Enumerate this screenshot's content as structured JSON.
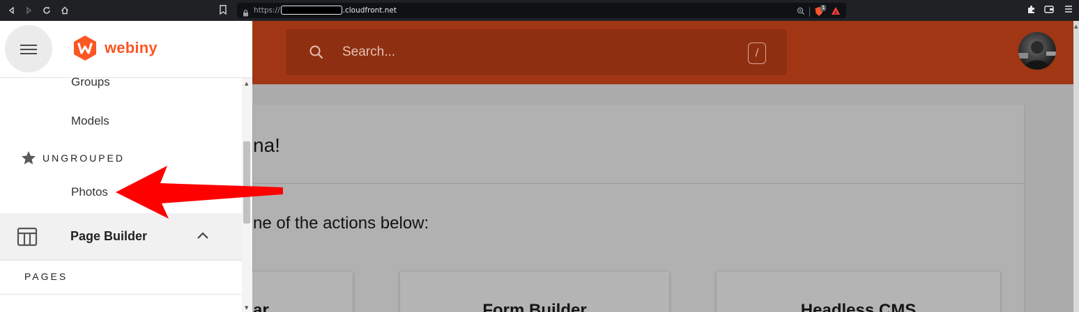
{
  "browser": {
    "url_scheme": "https://",
    "url_domain": ".cloudfront.net",
    "brave_badge": "1"
  },
  "header": {
    "search_placeholder": "Search...",
    "search_shortcut": "/"
  },
  "drawer": {
    "brand": "webiny",
    "items": {
      "groups": "Groups",
      "models": "Models",
      "ungrouped": "UNGROUPED",
      "photos": "Photos",
      "page_builder": "Page Builder",
      "pages": "PAGES"
    }
  },
  "main": {
    "greeting_fragment": "na!",
    "subtitle_fragment": "ne of the actions below:",
    "tiles": [
      "ar",
      "Form Builder",
      "Headless CMS"
    ]
  },
  "colors": {
    "brand_orange": "#fa5723",
    "header_dimmed": "#a13614",
    "annotation_arrow": "#ff0000"
  }
}
